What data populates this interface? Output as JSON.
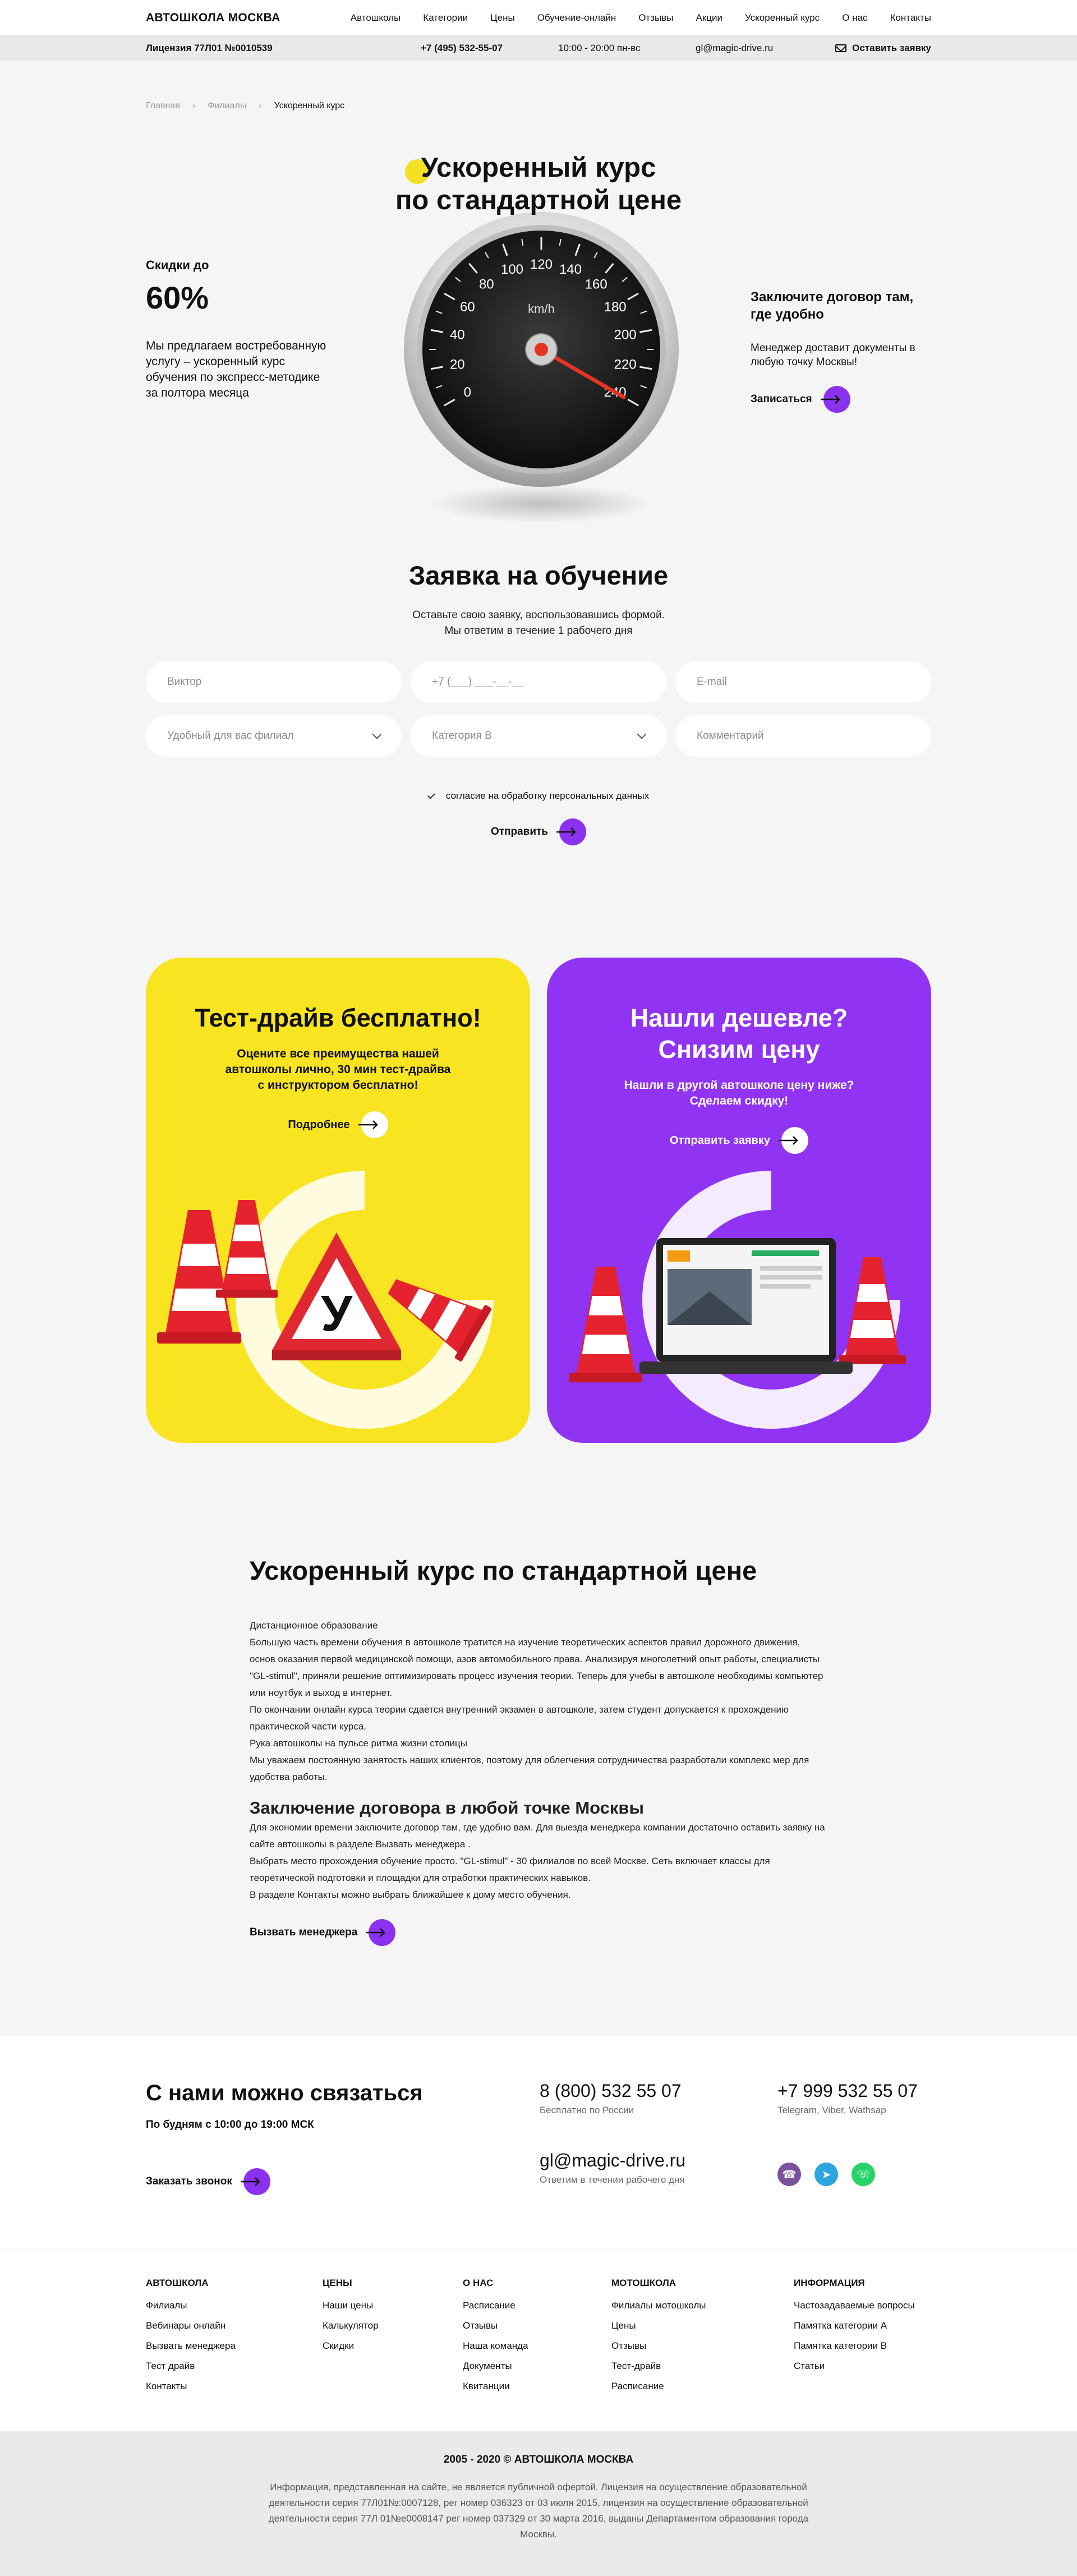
{
  "nav": {
    "logo": "АВТОШКОЛА МОСКВА",
    "items": [
      "Автошколы",
      "Категории",
      "Цены",
      "Обучение-онлайн",
      "Отзывы",
      "Акции",
      "Ускоренный курс",
      "О нас",
      "Контакты"
    ]
  },
  "infobar": {
    "license": "Лицензия 77Л01 №0010539",
    "phone": "+7 (495) 532-55-07",
    "hours": "10:00 - 20:00 пн-вс",
    "email": "gl@magic-drive.ru",
    "request": "Оставить заявку"
  },
  "breadcrumbs": [
    "Главная",
    "Филиалы",
    "Ускоренный курс"
  ],
  "hero": {
    "title_line1": "Ускоренный курс",
    "title_line2": "по стандартной цене",
    "discount_label": "Скидки до",
    "discount_value": "60%",
    "left_desc": "Мы предлагаем востребованную услугу – ускоренный курс обучения по экспресс-методике за полтора месяца",
    "right_title": "Заключите договор там, где удобно",
    "right_desc": "Менеджер доставит документы в любую точку Москвы!",
    "signup": "Записаться",
    "speedometer": {
      "unit": "km/h",
      "ticks": [
        "0",
        "20",
        "40",
        "60",
        "80",
        "100",
        "120",
        "140",
        "160",
        "180",
        "200",
        "220",
        "240"
      ]
    }
  },
  "form": {
    "title": "Заявка на обучение",
    "sub1": "Оставьте свою заявку, воспользовавшись формой.",
    "sub2": "Мы ответим в течение 1 рабочего дня",
    "name_value": "Виктор",
    "phone_placeholder": "+7 (___) ___-__-__",
    "email_placeholder": "E-mail",
    "branch_placeholder": "Удобный для вас филиал",
    "category_value": "Категория B",
    "comment_placeholder": "Комментарий",
    "consent": "согласие на обработку персональных данных",
    "submit": "Отправить"
  },
  "cards": {
    "yellow": {
      "title": "Тест-драйв бесплатно!",
      "text": "Оцените все преимущества нашей автошколы лично, 30 мин тест-драйва с инструктором бесплатно!",
      "link": "Подробнее",
      "sign_letter": "У"
    },
    "purple": {
      "title_line1": "Нашли дешевле?",
      "title_line2": "Снизим цену",
      "text": "Нашли в другой автошколе цену ниже? Сделаем скидку!",
      "link": "Отправить заявку"
    }
  },
  "article": {
    "title": "Ускоренный курс по стандартной цене",
    "p1": "Дистанционное образование",
    "p2": "Большую часть времени обучения в автошколе тратится на изучение теоретических аспектов правил дорожного движения, основ оказания первой медицинской помощи, азов автомобильного права. Анализируя многолетний опыт работы, специалисты \"GL-stimul\", приняли решение оптимизировать процесс изучения теории. Теперь для учебы в автошколе необходимы компьютер или ноутбук и выход в интернет.",
    "p3": "По окончании онлайн курса теории сдается внутренний экзамен в автошколе, затем студент допускается к прохождению практической части курса.",
    "p4": "Рука автошколы на пульсе ритма жизни столицы",
    "p5": "Мы уважаем постоянную занятость наших клиентов, поэтому для облегчения сотрудничества разработали комплекс мер для удобства работы.",
    "h2": "Заключение договора в любой точке Москвы",
    "p6": "Для экономии времени заключите договор там, где удобно вам. Для выезда менеджера компании достаточно оставить заявку на сайте автошколы в разделе Вызвать менеджера .",
    "p7": "Выбрать место прохождения обучение просто. \"GL-stimul\" - 30 филиалов по всей Москве. Сеть включает классы для теоретической подготовки и площадки для отработки практических навыков.",
    "p8": "В разделе Контакты можно выбрать ближайшее к дому место обучения.",
    "manager": "Вызвать менеджера"
  },
  "contact": {
    "title": "С нами можно связаться",
    "hours": "По будням с 10:00 до 19:00 МСК",
    "callback": "Заказать звонок",
    "phone1": "8 (800) 532 55 07",
    "phone1_note": "Бесплатно по России",
    "phone2": "+7 999 532 55 07",
    "phone2_note": "Telegram, Viber, Wathsap",
    "email": "gl@magic-drive.ru",
    "email_note": "Ответим в течении рабочего дня",
    "social_colors": {
      "viber": "#7b519d",
      "telegram": "#2ca5e0",
      "whatsapp": "#25d366"
    }
  },
  "footer": {
    "cols": [
      {
        "head": "АВТОШКОЛА",
        "items": [
          "Филиалы",
          "Вебинары онлайн",
          "Вызвать менеджера",
          "Тест драйв",
          "Контакты"
        ]
      },
      {
        "head": "ЦЕНЫ",
        "items": [
          "Наши цены",
          "Калькулятор",
          "Скидки"
        ]
      },
      {
        "head": "О НАС",
        "items": [
          "Расписание",
          "Отзывы",
          "Наша команда",
          "Документы",
          "Квитанции"
        ]
      },
      {
        "head": "МОТОШКОЛА",
        "items": [
          "Филиалы мотошколы",
          "Цены",
          "Отзывы",
          "Тест-драйв",
          "Расписание"
        ]
      },
      {
        "head": "ИНФОРМАЦИЯ",
        "items": [
          "Частозадаваемые вопросы",
          "Памятка категории А",
          "Памятка категории В",
          "Статьи"
        ]
      }
    ],
    "copyright": "2005 - 2020 © АВТОШКОЛА МОСКВА",
    "info": "Информация, представленная на сайте, не является публичной офертой. Лицензия на осуществление образовательной деятельности серия 77Л01№:0007128, рег номер 036323 от 03 июля 2015, лицензия на осуществление образовательной деятельности серия 77Л 01№е0008147 рег номер 037329 от 30 марта 2016, выданы Департаментом образования города Москвы."
  },
  "colors": {
    "accent": "#8b31f0",
    "yellow": "#f8e421",
    "purple": "#9033f2"
  }
}
